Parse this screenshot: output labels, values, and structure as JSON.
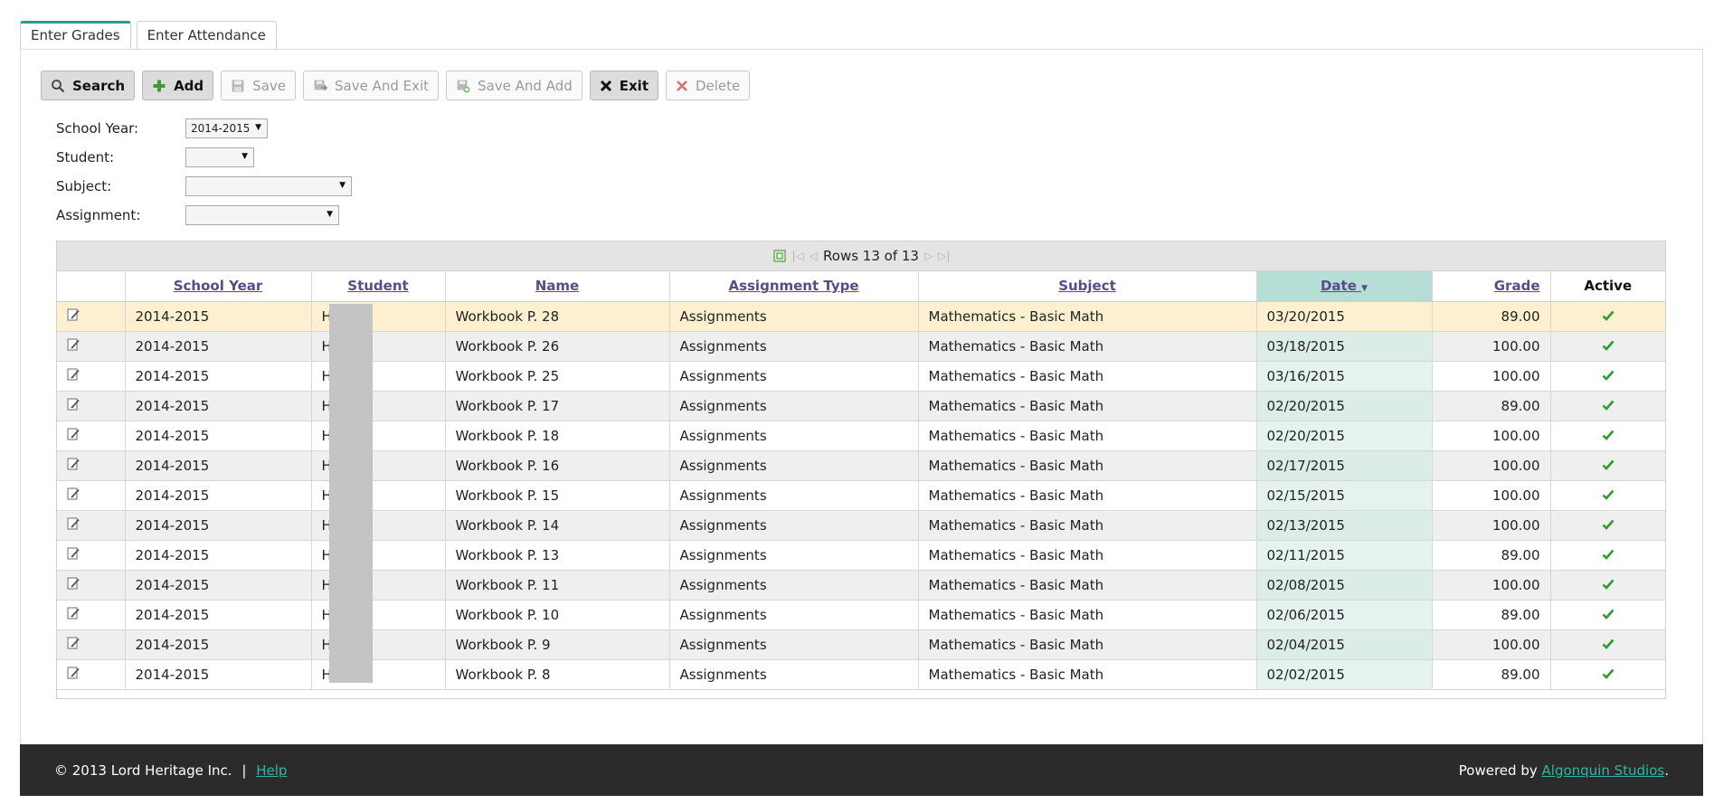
{
  "tabs": [
    {
      "label": "Enter Grades",
      "active": true
    },
    {
      "label": "Enter Attendance",
      "active": false
    }
  ],
  "toolbar": {
    "search": "Search",
    "add": "Add",
    "save": "Save",
    "save_and_exit": "Save And Exit",
    "save_and_add": "Save And Add",
    "exit": "Exit",
    "delete": "Delete"
  },
  "form": {
    "school_year_label": "School Year:",
    "school_year_value": "2014-2015",
    "student_label": "Student:",
    "student_value": "",
    "subject_label": "Subject:",
    "subject_value": "",
    "assignment_label": "Assignment:",
    "assignment_value": ""
  },
  "grid": {
    "pager_text": "Rows 13 of 13",
    "columns": [
      "School Year",
      "Student",
      "Name",
      "Assignment Type",
      "Subject",
      "Date",
      "Grade",
      "Active"
    ],
    "sorted_column": "Date",
    "rows": [
      {
        "school_year": "2014-2015",
        "student": "H",
        "name": "Workbook P. 28",
        "type": "Assignments",
        "subject": "Mathematics - Basic Math",
        "date": "03/20/2015",
        "grade": "89.00"
      },
      {
        "school_year": "2014-2015",
        "student": "H",
        "name": "Workbook P. 26",
        "type": "Assignments",
        "subject": "Mathematics - Basic Math",
        "date": "03/18/2015",
        "grade": "100.00"
      },
      {
        "school_year": "2014-2015",
        "student": "H",
        "name": "Workbook P. 25",
        "type": "Assignments",
        "subject": "Mathematics - Basic Math",
        "date": "03/16/2015",
        "grade": "100.00"
      },
      {
        "school_year": "2014-2015",
        "student": "H",
        "name": "Workbook P. 17",
        "type": "Assignments",
        "subject": "Mathematics - Basic Math",
        "date": "02/20/2015",
        "grade": "89.00"
      },
      {
        "school_year": "2014-2015",
        "student": "H",
        "name": "Workbook P. 18",
        "type": "Assignments",
        "subject": "Mathematics - Basic Math",
        "date": "02/20/2015",
        "grade": "100.00"
      },
      {
        "school_year": "2014-2015",
        "student": "H",
        "name": "Workbook P. 16",
        "type": "Assignments",
        "subject": "Mathematics - Basic Math",
        "date": "02/17/2015",
        "grade": "100.00"
      },
      {
        "school_year": "2014-2015",
        "student": "H",
        "name": "Workbook P. 15",
        "type": "Assignments",
        "subject": "Mathematics - Basic Math",
        "date": "02/15/2015",
        "grade": "100.00"
      },
      {
        "school_year": "2014-2015",
        "student": "H",
        "name": "Workbook P. 14",
        "type": "Assignments",
        "subject": "Mathematics - Basic Math",
        "date": "02/13/2015",
        "grade": "100.00"
      },
      {
        "school_year": "2014-2015",
        "student": "H",
        "name": "Workbook P. 13",
        "type": "Assignments",
        "subject": "Mathematics - Basic Math",
        "date": "02/11/2015",
        "grade": "89.00"
      },
      {
        "school_year": "2014-2015",
        "student": "H",
        "name": "Workbook P. 11",
        "type": "Assignments",
        "subject": "Mathematics - Basic Math",
        "date": "02/08/2015",
        "grade": "100.00"
      },
      {
        "school_year": "2014-2015",
        "student": "H",
        "name": "Workbook P. 10",
        "type": "Assignments",
        "subject": "Mathematics - Basic Math",
        "date": "02/06/2015",
        "grade": "89.00"
      },
      {
        "school_year": "2014-2015",
        "student": "H",
        "name": "Workbook P. 9",
        "type": "Assignments",
        "subject": "Mathematics - Basic Math",
        "date": "02/04/2015",
        "grade": "100.00"
      },
      {
        "school_year": "2014-2015",
        "student": "H",
        "name": "Workbook P. 8",
        "type": "Assignments",
        "subject": "Mathematics - Basic Math",
        "date": "02/02/2015",
        "grade": "89.00"
      }
    ]
  },
  "footer": {
    "copyright": "© 2013 Lord Heritage Inc.",
    "separator": "|",
    "help": "Help",
    "powered_by": "Powered by",
    "vendor": "Algonquin Studios",
    "period": "."
  },
  "colors": {
    "accent": "#2a9d8a",
    "header_link": "#5b4a8b",
    "sorted_header": "#b6ddd6",
    "selected_row": "#fcf0d0",
    "check": "#2e9b2e",
    "footer_bg": "#2b2b2b"
  }
}
